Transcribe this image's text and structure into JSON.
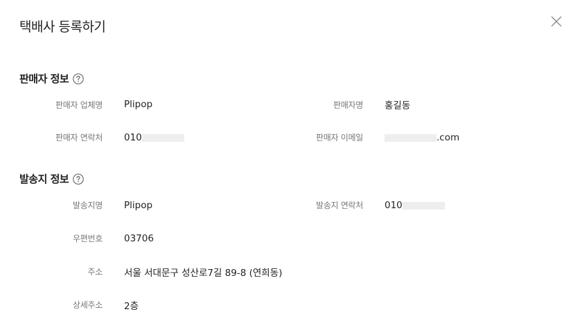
{
  "title": "택배사 등록하기",
  "seller_section": {
    "title": "판매자 정보",
    "company_label": "판매자 업체명",
    "company_value": "Plipop",
    "name_label": "판매자명",
    "name_value": "홍길동",
    "phone_label": "판매자 연락처",
    "phone_prefix": "010",
    "email_label": "판매자 이메일",
    "email_suffix": ".com"
  },
  "shipping_section": {
    "title": "발송지 정보",
    "place_label": "발송지명",
    "place_value": "Plipop",
    "phone_label": "발송지 연락처",
    "phone_prefix": "010",
    "zip_label": "우편번호",
    "zip_value": "03706",
    "address_label": "주소",
    "address_value": "서울 서대문구 성산로7길 89-8 (연희동)",
    "detail_label": "상세주소",
    "detail_value": "2층"
  },
  "icons": {
    "close": "close-icon",
    "help": "question-circle-icon"
  },
  "colors": {
    "text": "#222222",
    "label": "#777777",
    "mask": "#eeeeee"
  }
}
